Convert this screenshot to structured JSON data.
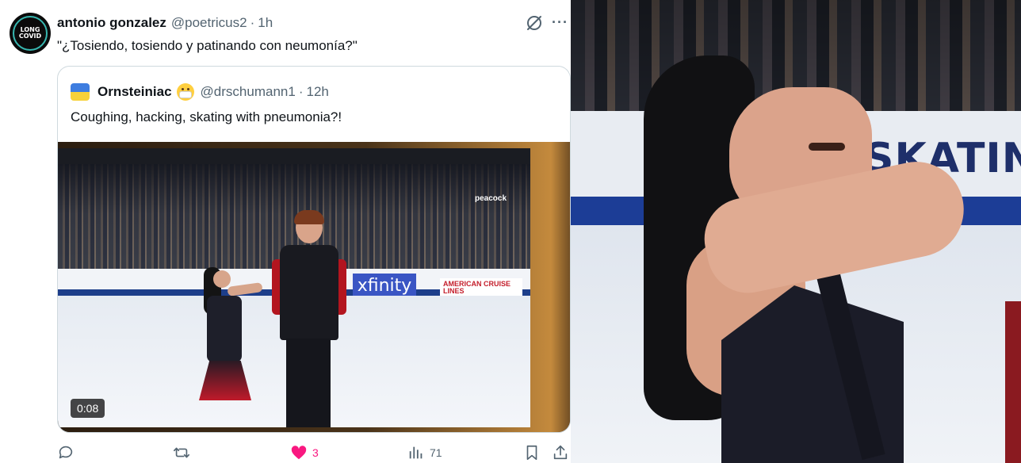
{
  "tweet": {
    "author_name": "antonio gonzalez",
    "author_handle": "@poetricus2",
    "separator": "·",
    "time": "1h",
    "text": "\"¿Tosiendo, tosiendo y patinando con neumonía?\"",
    "avatar": {
      "line1": "LONG",
      "line2": "COVID",
      "ring_color": "#37b7b0"
    },
    "more_icon": "···"
  },
  "quote": {
    "author_name": "Ornsteiniac",
    "author_handle": "@drschumann1",
    "separator": "·",
    "time": "12h",
    "text": "Coughing, hacking, skating with pneumonia?!",
    "flag_colors": [
      "#3e7de0",
      "#f7d13a"
    ],
    "video": {
      "duration": "0:08",
      "broadcaster": "peacock",
      "board_brand": "xfinity",
      "board_banner": "AMERICAN CRUISE LINES"
    }
  },
  "actions": {
    "reply": {
      "icon": "reply-icon",
      "count": ""
    },
    "repost": {
      "icon": "repost-icon",
      "count": ""
    },
    "like": {
      "icon": "heart-icon",
      "count": "3",
      "color": "#f91880",
      "liked": true
    },
    "views": {
      "icon": "views-icon",
      "count": "71"
    },
    "bookmark": {
      "icon": "bookmark-icon"
    },
    "share": {
      "icon": "share-icon"
    }
  },
  "zoom_frame": {
    "board_text": "SKATING C"
  },
  "colors": {
    "text_primary": "#0f1419",
    "text_secondary": "#536471",
    "border": "#cfd9de",
    "like_pink": "#f91880"
  }
}
